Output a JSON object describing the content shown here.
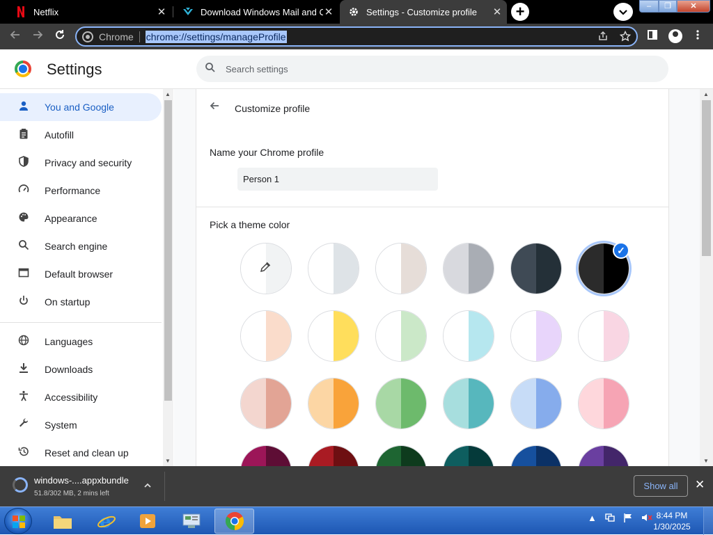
{
  "tabs": [
    {
      "title": "Netflix",
      "icon": "netflix-icon"
    },
    {
      "title": "Download Windows Mail and Ca",
      "icon": "download-site-icon"
    },
    {
      "title": "Settings - Customize profile",
      "icon": "gear-icon"
    }
  ],
  "toolbar": {
    "site_label": "Chrome",
    "url": "chrome://settings/manageProfile"
  },
  "header": {
    "title": "Settings",
    "search_placeholder": "Search settings"
  },
  "sidebar": {
    "items": [
      {
        "label": "You and Google",
        "icon": "person-icon",
        "active": true
      },
      {
        "label": "Autofill",
        "icon": "clipboard-icon"
      },
      {
        "label": "Privacy and security",
        "icon": "shield-icon"
      },
      {
        "label": "Performance",
        "icon": "speedometer-icon"
      },
      {
        "label": "Appearance",
        "icon": "palette-icon"
      },
      {
        "label": "Search engine",
        "icon": "search-icon"
      },
      {
        "label": "Default browser",
        "icon": "browser-window-icon"
      },
      {
        "label": "On startup",
        "icon": "power-icon"
      },
      {
        "label": "Languages",
        "icon": "globe-icon"
      },
      {
        "label": "Downloads",
        "icon": "download-icon"
      },
      {
        "label": "Accessibility",
        "icon": "accessibility-icon"
      },
      {
        "label": "System",
        "icon": "wrench-icon"
      },
      {
        "label": "Reset and clean up",
        "icon": "history-icon"
      }
    ]
  },
  "main": {
    "title": "Customize profile",
    "name_label": "Name your Chrome profile",
    "name_value": "Person 1",
    "theme_label": "Pick a theme color",
    "selected_theme_index": 5,
    "theme_colors": [
      [
        "#ffffff",
        "#f1f3f4"
      ],
      [
        "#ffffff",
        "#dee3e7"
      ],
      [
        "#ffffff",
        "#e6ddd8"
      ],
      [
        "#d8d9de",
        "#a9adb4"
      ],
      [
        "#3f4a55",
        "#243038"
      ],
      [
        "#2b2b2b",
        "#000000"
      ],
      [
        "#ffffff",
        "#fadccb"
      ],
      [
        "#ffffff",
        "#ffde5c"
      ],
      [
        "#ffffff",
        "#cbe8c8"
      ],
      [
        "#ffffff",
        "#b6e7ef"
      ],
      [
        "#ffffff",
        "#e8d5fb"
      ],
      [
        "#ffffff",
        "#f9d6e3"
      ],
      [
        "#f3d6cf",
        "#e2a495"
      ],
      [
        "#fcd6a4",
        "#f9a33a"
      ],
      [
        "#a8d8a5",
        "#6dba6c"
      ],
      [
        "#a7dede",
        "#57b7bd"
      ],
      [
        "#c7dcf7",
        "#86acec"
      ],
      [
        "#fed7dc",
        "#f6a4b4"
      ],
      [
        "#9c1658",
        "#5e0d35"
      ],
      [
        "#a91b23",
        "#6e0f12"
      ],
      [
        "#1e6532",
        "#0e3b1d"
      ],
      [
        "#0e5e5f",
        "#053a3a"
      ],
      [
        "#16509e",
        "#0b3166"
      ],
      [
        "#6a3fa0",
        "#43266a"
      ]
    ]
  },
  "download": {
    "filename": "windows-....appxbundle",
    "status": "51.8/302 MB, 2 mins left",
    "show_all": "Show all"
  },
  "taskbar": {
    "time": "8:44 PM",
    "date": "1/30/2025"
  }
}
